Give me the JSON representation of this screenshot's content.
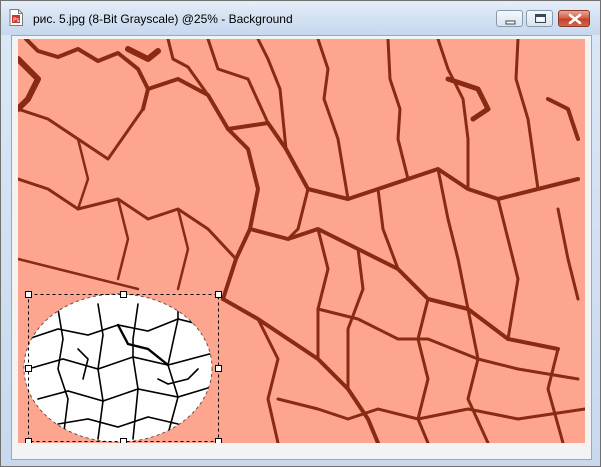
{
  "window": {
    "title": "рис. 5.jpg (8-Bit Grayscale) @25% - Background",
    "doc_icon": "photoshop-document-icon",
    "buttons": {
      "minimize_icon": "minimize-icon",
      "maximize_icon": "maximize-icon",
      "close_icon": "close-icon"
    }
  },
  "canvas": {
    "image_colors": {
      "background": "#fda58e",
      "cracks": "#8a2a12",
      "selection_fill": "#ffffff",
      "selection_cracks": "#000000"
    },
    "selection": {
      "shape": "ellipse",
      "handle_icon": "transform-handle"
    }
  }
}
